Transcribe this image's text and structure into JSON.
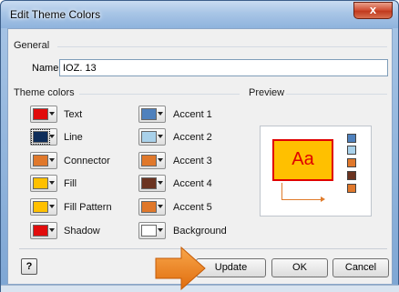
{
  "window": {
    "title": "Edit Theme Colors",
    "close_glyph": "x"
  },
  "general": {
    "group_label": "General",
    "name_label": "Name:",
    "name_value": "IOZ. 13"
  },
  "theme_colors": {
    "group_label": "Theme colors",
    "left": [
      {
        "label": "Text",
        "color": "#e10c0c"
      },
      {
        "label": "Line",
        "color": "#0e2d5a"
      },
      {
        "label": "Connector",
        "color": "#e0782b"
      },
      {
        "label": "Fill",
        "color": "#ffc000"
      },
      {
        "label": "Fill Pattern",
        "color": "#ffc000"
      },
      {
        "label": "Shadow",
        "color": "#e10c0c"
      }
    ],
    "right": [
      {
        "label": "Accent 1",
        "color": "#4f81bd"
      },
      {
        "label": "Accent 2",
        "color": "#a9d1ea"
      },
      {
        "label": "Accent 3",
        "color": "#e0782b"
      },
      {
        "label": "Accent 4",
        "color": "#6b3320"
      },
      {
        "label": "Accent 5",
        "color": "#e0782b"
      },
      {
        "label": "Background",
        "color": "#ffffff"
      }
    ]
  },
  "preview": {
    "group_label": "Preview",
    "sample_text": "Aa",
    "fill_color": "#ffc000",
    "accent_swatches": [
      "#4f81bd",
      "#a9d1ea",
      "#e0782b",
      "#6b3320",
      "#e0782b"
    ]
  },
  "buttons": {
    "help": "?",
    "update": "Update",
    "ok": "OK",
    "cancel": "Cancel"
  },
  "annotation": {
    "arrow_color": "#f07f1a",
    "icon": "arrow-right-icon"
  }
}
